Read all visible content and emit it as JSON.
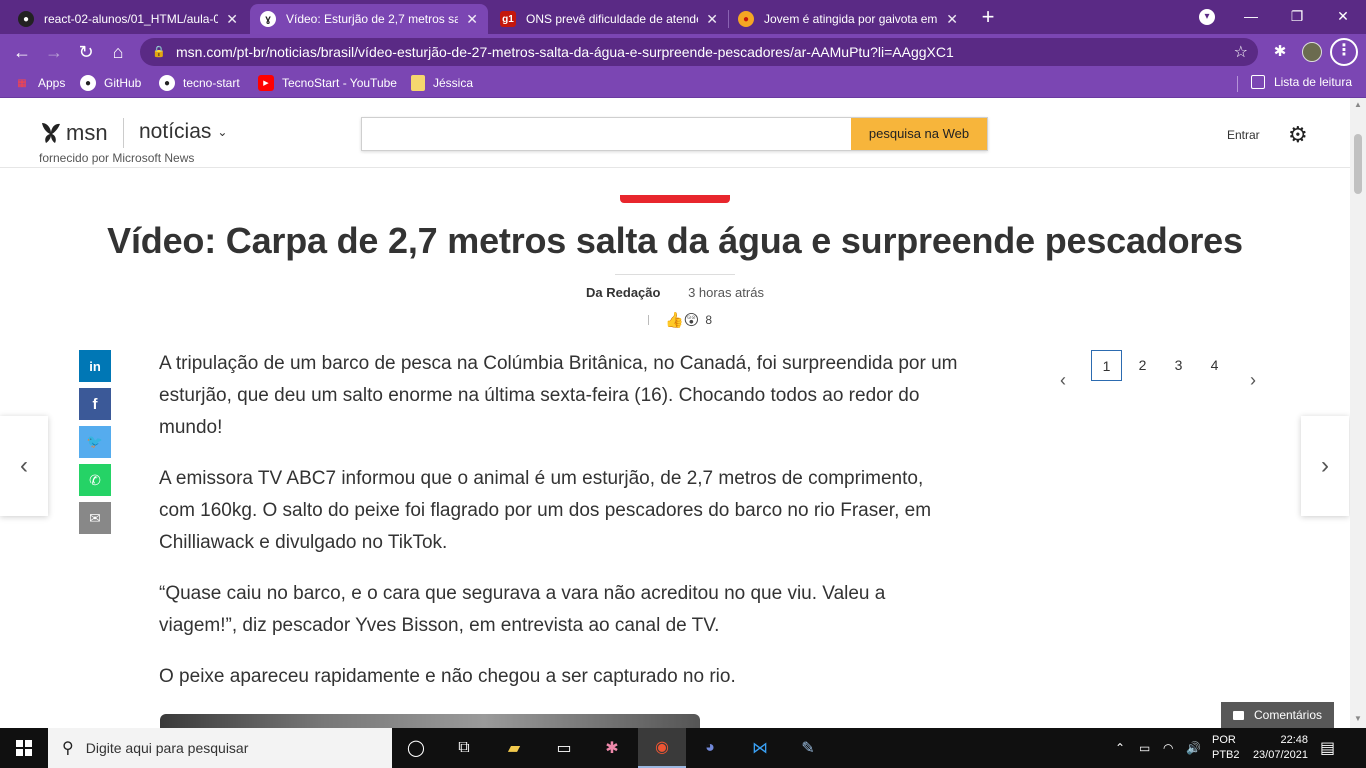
{
  "browser": {
    "tabs": [
      {
        "title": "react-02-alunos/01_HTML/aula-0",
        "favicon": "github-icon",
        "active": false
      },
      {
        "title": "Vídeo: Esturjão de 2,7 metros salt",
        "favicon": "msn-icon",
        "active": true
      },
      {
        "title": "ONS prevê dificuldade de atende",
        "favicon": "g1-icon",
        "active": false
      },
      {
        "title": "Jovem é atingida por gaivota em",
        "favicon": "news-icon",
        "active": false
      }
    ],
    "url": "msn.com/pt-br/noticias/brasil/vídeo-esturjão-de-27-metros-salta-da-água-e-surpreende-pescadores/ar-AAMuPtu?li=AAggXC1",
    "bookmarks": [
      "Apps",
      "GitHub",
      "tecno-start",
      "TecnoStart - YouTube",
      "Jéssica"
    ],
    "reading_list": "Lista de leitura",
    "theme_color": "#7b46b3"
  },
  "msn": {
    "logo": "msn",
    "section": "notícias",
    "powered_by": "fornecido por Microsoft News",
    "search_placeholder": "",
    "search_button": "pesquisa na Web",
    "sign_in": "Entrar"
  },
  "article": {
    "title": "Vídeo: Carpa de 2,7 metros salta da água e surpreende pescadores",
    "author": "Da Redação",
    "time": "3 horas atrás",
    "reaction_count": "8",
    "paragraphs": [
      "A tripulação de um barco de pesca na Colúmbia Britânica, no Canadá, foi surpreendida por um esturjão, que deu um salto enorme na última sexta-feira (16). Chocando todos ao redor do mundo!",
      "A emissora TV ABC7 informou que o animal é um esturjão, de 2,7 metros de comprimento, com 160kg. O salto do peixe foi flagrado por um dos pescadores do barco no rio Fraser, em Chilliawack e divulgado no TikTok.",
      "“Quase caiu no barco, e o cara que segurava a vara não acreditou no que viu. Valeu a viagem!”, diz pescador Yves Bisson, em entrevista ao canal de TV.",
      "O peixe apareceu rapidamente e não chegou a ser capturado no rio."
    ],
    "pages": [
      "1",
      "2",
      "3",
      "4"
    ],
    "current_page": "1",
    "comments_label": "Comentários",
    "share_colors": {
      "linkedin": "#0077b5",
      "facebook": "#3b5998",
      "twitter": "#55acee",
      "whatsapp": "#25d366",
      "email": "#888888"
    }
  },
  "taskbar": {
    "search_placeholder": "Digite aqui para pesquisar",
    "lang_top": "POR",
    "lang_bottom": "PTB2",
    "time": "22:48",
    "date": "23/07/2021"
  }
}
